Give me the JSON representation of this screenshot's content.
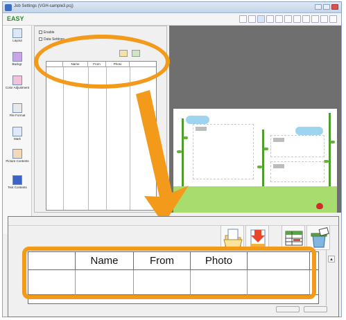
{
  "window": {
    "title": "Job Settings (VGH-sample3.pcj)"
  },
  "toolbar": {
    "logo": "EASY"
  },
  "sidebar": {
    "items": [
      {
        "label": "Layout",
        "icon": "layout-icon"
      },
      {
        "label": "Backgr.",
        "icon": "background-icon"
      },
      {
        "label": "Color Adjustment",
        "icon": "color-adjustment-icon"
      },
      {
        "label": "File Format",
        "icon": "file-format-icon"
      },
      {
        "label": "Mark",
        "icon": "mark-icon"
      },
      {
        "label": "Picture Contents",
        "icon": "picture-contents-icon"
      },
      {
        "label": "Text Contents",
        "icon": "text-contents-icon"
      }
    ]
  },
  "mini_panel": {
    "checkbox1": "Enable",
    "checkbox2": "Data Settings",
    "columns": [
      "",
      "Name",
      "From",
      "Photo",
      ""
    ]
  },
  "zoom": {
    "columns": [
      "",
      "Name",
      "From",
      "Photo",
      ""
    ],
    "buttons": [
      "open-data-file-icon",
      "import-data-icon",
      "edit-table-icon",
      "clear-table-icon"
    ]
  },
  "colors": {
    "highlight": "#f39a1b",
    "grass": "#a9dc6e",
    "preview_bg": "#6f6f6f"
  }
}
